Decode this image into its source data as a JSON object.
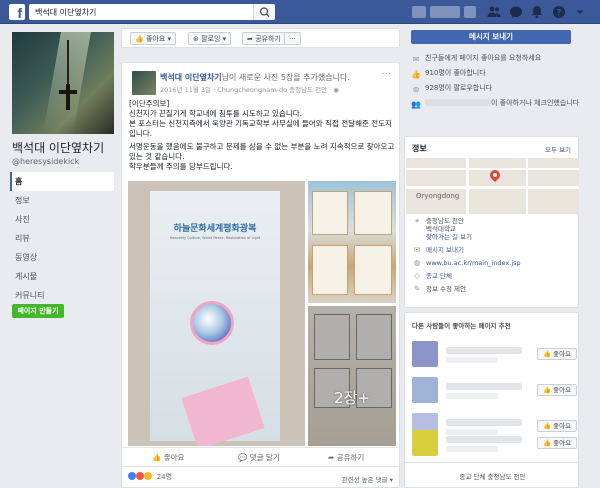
{
  "topbar": {
    "search_value": "백석대 이단옆차기",
    "icons": [
      "facebook-logo",
      "search-icon",
      "friends-icon",
      "messages-icon",
      "notifications-icon",
      "help-icon",
      "dropdown-icon"
    ]
  },
  "left": {
    "page_name": "백석대 이단옆차기",
    "handle": "@heresysidekick",
    "nav": [
      "홈",
      "정보",
      "사진",
      "리뷰",
      "동영상",
      "게시물",
      "커뮤니티"
    ],
    "create_page": "페이지 만들기"
  },
  "action_bar": {
    "like": "좋아요",
    "follow": "팔로잉",
    "share": "공유하기",
    "more": "···"
  },
  "post": {
    "author": "백석대 이단옆차기",
    "action": "님이 새로운 사진 5장을 추가했습니다.",
    "meta": "2016년 11월 3일 · Chungcheongnam-do 충청남도 천안 · ",
    "paragraphs": [
      "[이단주의보]",
      "신천지가 끈질기게 학교내에 침투를 시도하고 있습니다.",
      "본 포스터는 신천지측에서 욱양관 기독교학부 사무실에 들어와 직접 전달해준 전도지 입니다.",
      "서명운동을 했음에도 불구하고 문제를 삼을 수 없는 부분을 노려 지속적으로 찾아오고 있는 것 같습니다.",
      "학우분들께 주의를 당부드립니다."
    ],
    "brochure_title": "하늘문화세계평화광복",
    "brochure_subtitle": "Heavenly Culture, World Peace, Restoration of Light",
    "more_photos": "2장+",
    "actions": [
      "좋아요",
      "댓글 달기",
      "공유하기"
    ],
    "reaction_count": "24명",
    "sort": "관련성 높은 댓글 ▾"
  },
  "right": {
    "message_button": "메시지 보내기",
    "stats": [
      {
        "icon": "invite-icon",
        "text": "친구들에게 페이지 좋아요를 요청하세요"
      },
      {
        "icon": "like-icon",
        "text": "910명이 좋아합니다"
      },
      {
        "icon": "follow-icon",
        "text": "928명이 팔로우합니다"
      },
      {
        "icon": "people-icon",
        "text": "이 좋아하거나 체크인했습니다"
      }
    ],
    "info": {
      "title": "정보",
      "see_all": "모두 보기",
      "map_label": "Oryongdong",
      "rows": [
        {
          "icon": "location-icon",
          "text": "충청남도 천안\n백석대학교\n찾아가는 길 보기"
        },
        {
          "icon": "messenger-icon",
          "text": "메시지 보내기"
        },
        {
          "icon": "globe-icon",
          "text": "www.bu.ac.kr/main_index.jsp"
        },
        {
          "icon": "tag-icon",
          "text": "종교 단체"
        },
        {
          "icon": "edit-icon",
          "text": "정보 수정 제안"
        }
      ]
    },
    "suggestions": {
      "title": "다른 사람들이 좋아하는 페이지 추천",
      "like_label": "좋아요",
      "thumb_colors": [
        "#8b95c9",
        "#9fb3d6",
        "#b6bfe0",
        "#d8cf3e"
      ],
      "footer": "종교 단체 충청남도 천안"
    }
  }
}
